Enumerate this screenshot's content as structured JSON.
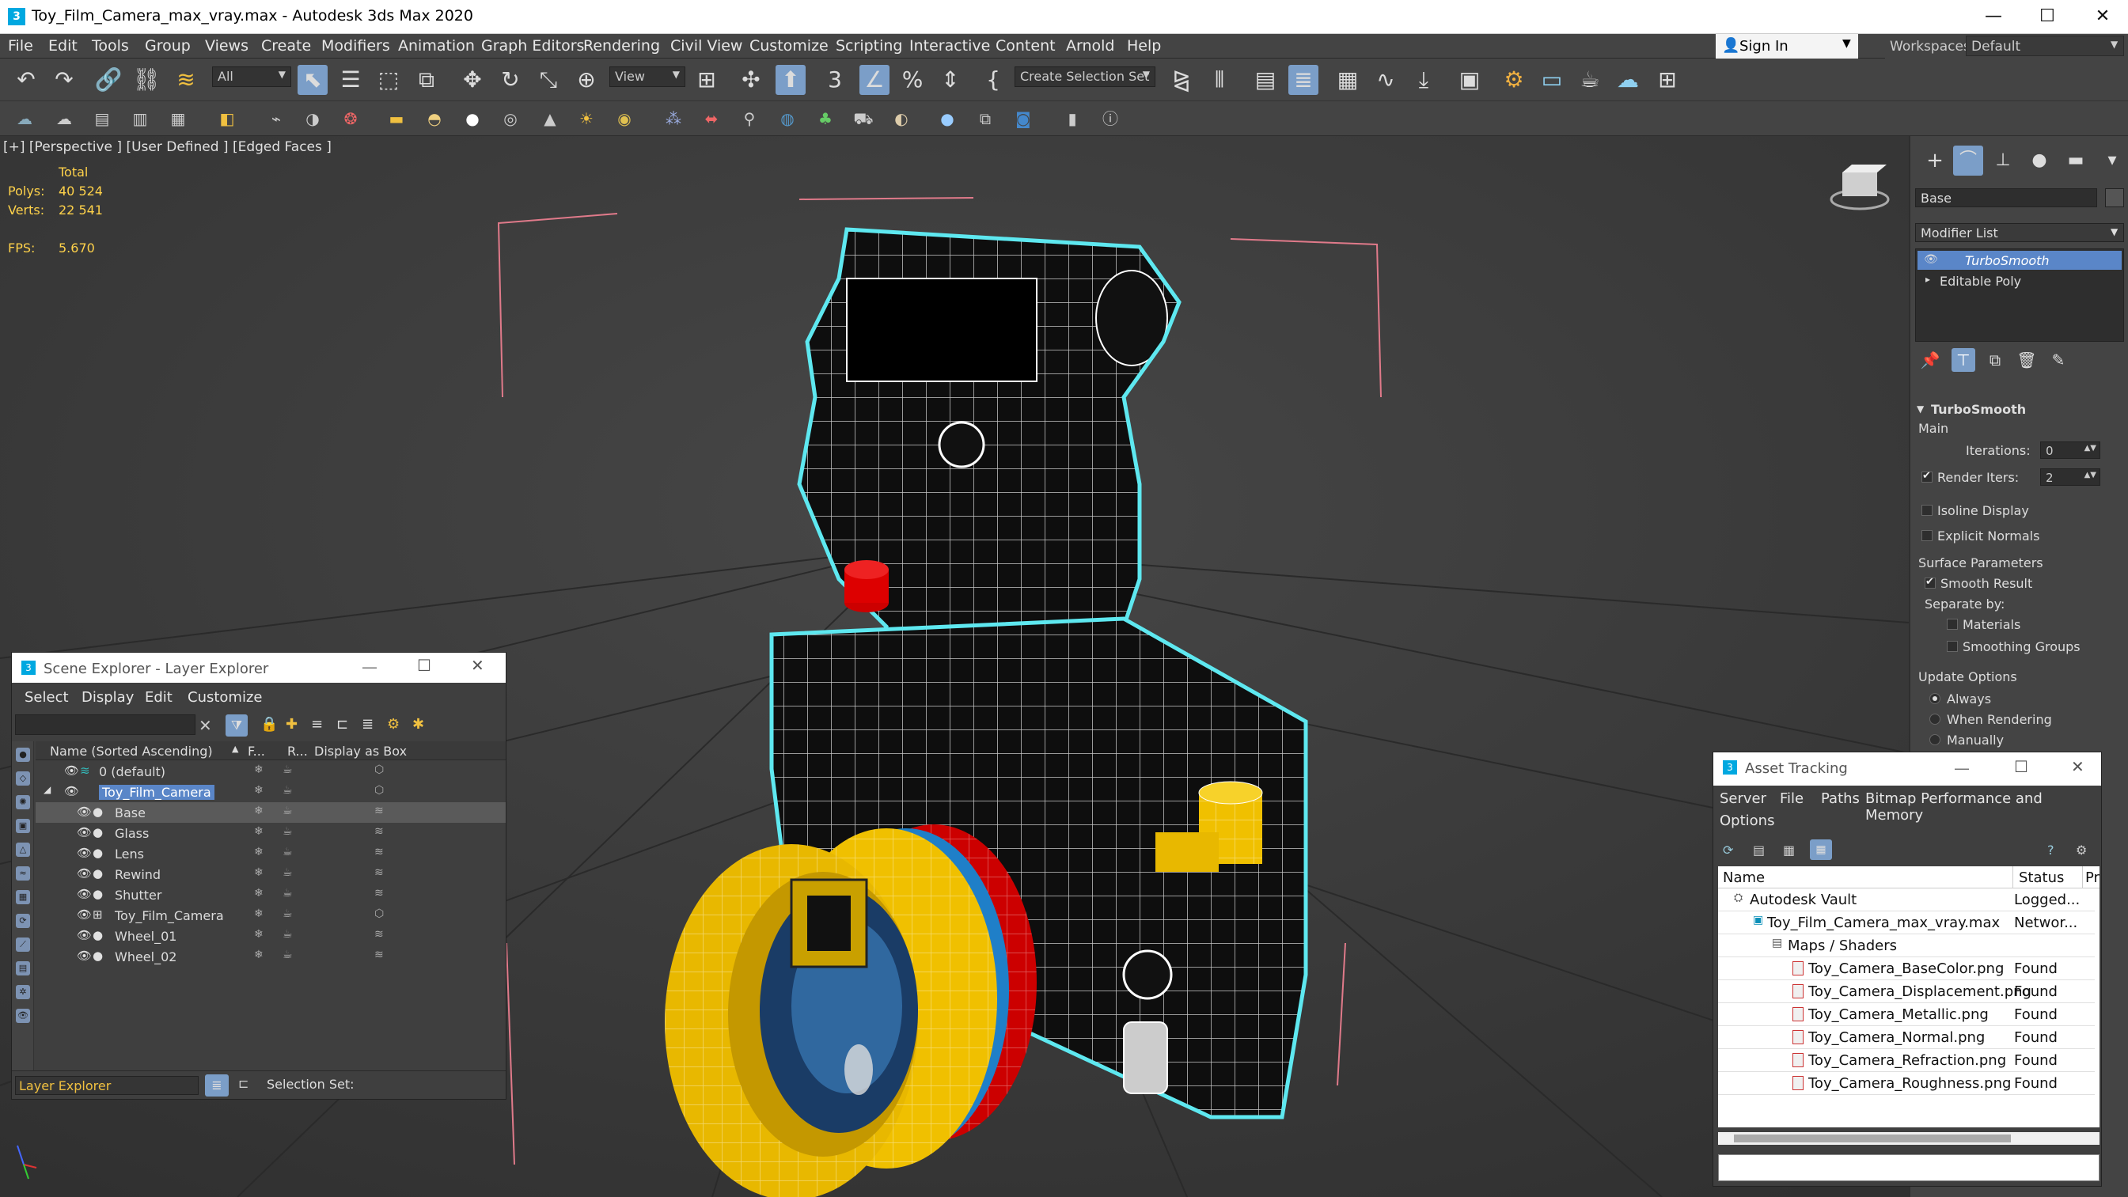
{
  "window": {
    "title": "Toy_Film_Camera_max_vray.max - Autodesk 3ds Max 2020"
  },
  "menu": [
    "File",
    "Edit",
    "Tools",
    "Group",
    "Views",
    "Create",
    "Modifiers",
    "Animation",
    "Graph Editors",
    "Rendering",
    "Civil View",
    "Customize",
    "Scripting",
    "Interactive",
    "Content",
    "Arnold",
    "Help"
  ],
  "signin": {
    "label": "Sign In"
  },
  "workspaces": {
    "label": "Workspaces:",
    "value": "Default"
  },
  "toolbar": {
    "filter_value": "All",
    "refcoord_value": "View",
    "selection_set_placeholder": "Create Selection Set",
    "snap_number": "3"
  },
  "viewport": {
    "label": "[+] [Perspective ] [User Defined ] [Edged Faces ]",
    "stats": {
      "total_label": "Total",
      "polys_label": "Polys:",
      "polys_value": "40 524",
      "verts_label": "Verts:",
      "verts_value": "22 541",
      "fps_label": "FPS:",
      "fps_value": "5.670"
    }
  },
  "command_panel": {
    "object_name": "Base",
    "modifier_list_label": "Modifier List",
    "stack": [
      "TurboSmooth",
      "Editable Poly"
    ],
    "rollout_title": "TurboSmooth",
    "main_label": "Main",
    "iterations_label": "Iterations:",
    "iterations_value": "0",
    "render_iters_label": "Render Iters:",
    "render_iters_value": "2",
    "isoline_label": "Isoline Display",
    "explicit_label": "Explicit Normals",
    "surface_params_label": "Surface Parameters",
    "smooth_result_label": "Smooth Result",
    "separate_by_label": "Separate by:",
    "materials_label": "Materials",
    "smoothing_groups_label": "Smoothing Groups",
    "update_options_label": "Update Options",
    "always_label": "Always",
    "when_rendering_label": "When Rendering",
    "manually_label": "Manually"
  },
  "scene_explorer": {
    "title": "Scene Explorer - Layer Explorer",
    "menu": [
      "Select",
      "Display",
      "Edit",
      "Customize"
    ],
    "columns": {
      "name": "Name (Sorted Ascending)",
      "f": "F...",
      "r": "R...",
      "box": "Display as Box"
    },
    "rows": [
      {
        "name": "0 (default)",
        "level": 1
      },
      {
        "name": "Toy_Film_Camera",
        "level": 1
      },
      {
        "name": "Base",
        "level": 2
      },
      {
        "name": "Glass",
        "level": 2
      },
      {
        "name": "Lens",
        "level": 2
      },
      {
        "name": "Rewind",
        "level": 2
      },
      {
        "name": "Shutter",
        "level": 2
      },
      {
        "name": "Toy_Film_Camera",
        "level": 2
      },
      {
        "name": "Wheel_01",
        "level": 2
      },
      {
        "name": "Wheel_02",
        "level": 2
      }
    ],
    "footer_dropdown": "Layer Explorer",
    "selection_set_label": "Selection Set:"
  },
  "asset_tracking": {
    "title": "Asset Tracking",
    "menu": [
      "Server",
      "File",
      "Paths",
      "Bitmap Performance and Memory"
    ],
    "menu2": "Options",
    "columns": {
      "name": "Name",
      "status": "Status",
      "pr": "Pr"
    },
    "rows": [
      {
        "name": "Autodesk Vault",
        "status": "Logged..."
      },
      {
        "name": "Toy_Film_Camera_max_vray.max",
        "status": "Networ..."
      },
      {
        "name": "Maps / Shaders",
        "status": ""
      },
      {
        "name": "Toy_Camera_BaseColor.png",
        "status": "Found"
      },
      {
        "name": "Toy_Camera_Displacement.png",
        "status": "Found"
      },
      {
        "name": "Toy_Camera_Metallic.png",
        "status": "Found"
      },
      {
        "name": "Toy_Camera_Normal.png",
        "status": "Found"
      },
      {
        "name": "Toy_Camera_Refraction.png",
        "status": "Found"
      },
      {
        "name": "Toy_Camera_Roughness.png",
        "status": "Found"
      }
    ]
  }
}
